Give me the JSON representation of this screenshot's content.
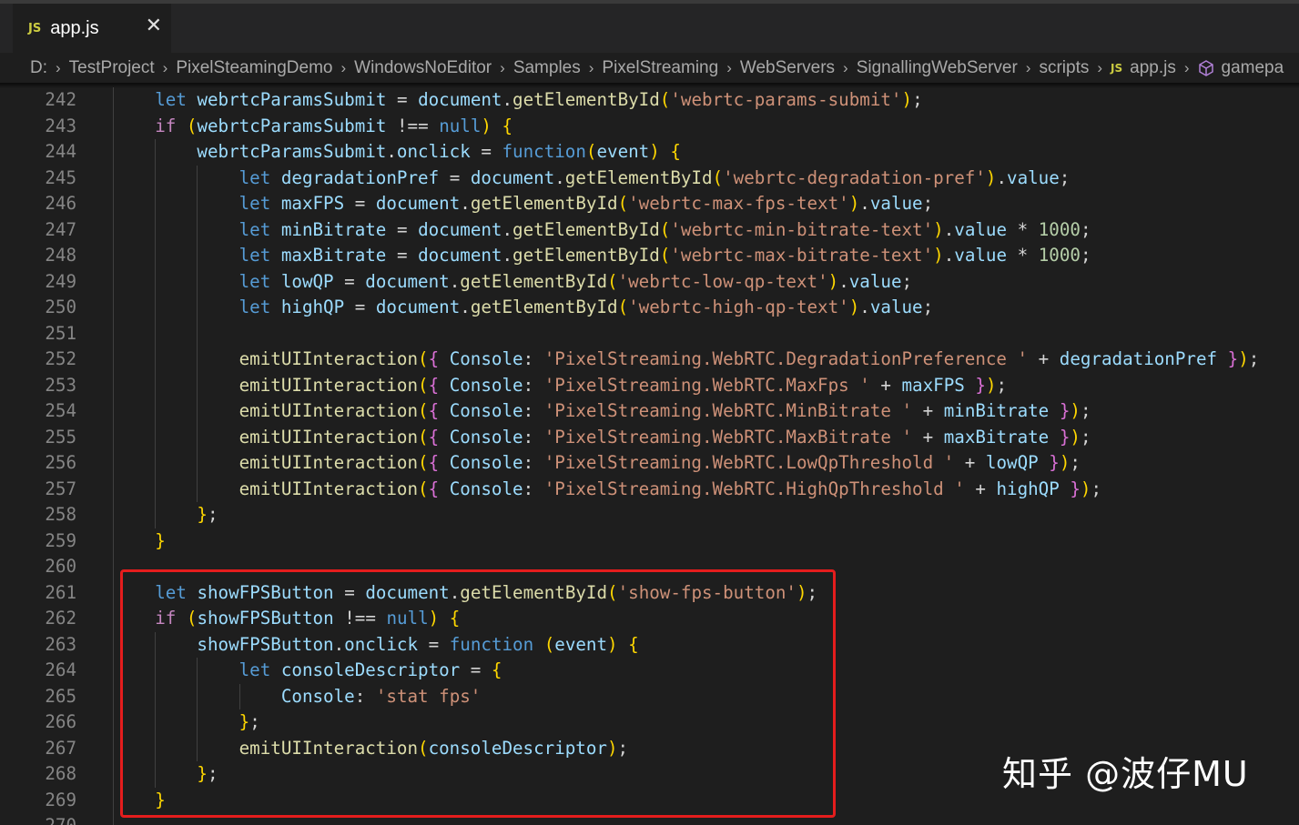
{
  "tab": {
    "icon": "javascript-file-icon",
    "badge": "JS",
    "filename": "app.js"
  },
  "breadcrumb": [
    "D:",
    "TestProject",
    "PixelSteamingDemo",
    "WindowsNoEditor",
    "Samples",
    "PixelStreaming",
    "WebServers",
    "SignallingWebServer",
    "scripts",
    "app.js",
    "gamepa"
  ],
  "code_lines": [
    {
      "n": "242",
      "text": "    let webrtcParamsSubmit = document.getElementById('webrtc-params-submit');"
    },
    {
      "n": "243",
      "text": "    if (webrtcParamsSubmit !== null) {"
    },
    {
      "n": "244",
      "text": "        webrtcParamsSubmit.onclick = function(event) {"
    },
    {
      "n": "245",
      "text": "            let degradationPref = document.getElementById('webrtc-degradation-pref').value;"
    },
    {
      "n": "246",
      "text": "            let maxFPS = document.getElementById('webrtc-max-fps-text').value;"
    },
    {
      "n": "247",
      "text": "            let minBitrate = document.getElementById('webrtc-min-bitrate-text').value * 1000;"
    },
    {
      "n": "248",
      "text": "            let maxBitrate = document.getElementById('webrtc-max-bitrate-text').value * 1000;"
    },
    {
      "n": "249",
      "text": "            let lowQP = document.getElementById('webrtc-low-qp-text').value;"
    },
    {
      "n": "250",
      "text": "            let highQP = document.getElementById('webrtc-high-qp-text').value;"
    },
    {
      "n": "251",
      "text": ""
    },
    {
      "n": "252",
      "text": "            emitUIInteraction({ Console: 'PixelStreaming.WebRTC.DegradationPreference ' + degradationPref });"
    },
    {
      "n": "253",
      "text": "            emitUIInteraction({ Console: 'PixelStreaming.WebRTC.MaxFps ' + maxFPS });"
    },
    {
      "n": "254",
      "text": "            emitUIInteraction({ Console: 'PixelStreaming.WebRTC.MinBitrate ' + minBitrate });"
    },
    {
      "n": "255",
      "text": "            emitUIInteraction({ Console: 'PixelStreaming.WebRTC.MaxBitrate ' + maxBitrate });"
    },
    {
      "n": "256",
      "text": "            emitUIInteraction({ Console: 'PixelStreaming.WebRTC.LowQpThreshold ' + lowQP });"
    },
    {
      "n": "257",
      "text": "            emitUIInteraction({ Console: 'PixelStreaming.WebRTC.HighQpThreshold ' + highQP });"
    },
    {
      "n": "258",
      "text": "        };"
    },
    {
      "n": "259",
      "text": "    }"
    },
    {
      "n": "260",
      "text": ""
    },
    {
      "n": "261",
      "text": "    let showFPSButton = document.getElementById('show-fps-button');"
    },
    {
      "n": "262",
      "text": "    if (showFPSButton !== null) {"
    },
    {
      "n": "263",
      "text": "        showFPSButton.onclick = function (event) {"
    },
    {
      "n": "264",
      "text": "            let consoleDescriptor = {"
    },
    {
      "n": "265",
      "text": "                Console: 'stat fps'"
    },
    {
      "n": "266",
      "text": "            };"
    },
    {
      "n": "267",
      "text": "            emitUIInteraction(consoleDescriptor);"
    },
    {
      "n": "268",
      "text": "        };"
    },
    {
      "n": "269",
      "text": "    }"
    },
    {
      "n": "270",
      "text": ""
    }
  ],
  "highlight_box": {
    "color": "#e51d1d",
    "from_line": "261",
    "to_line": "269"
  },
  "watermark": "知乎 @波仔MU",
  "colors": {
    "editor_bg": "#1e1e1e",
    "keyword": "#569cd6",
    "control": "#c586c0",
    "variable": "#9cdcfe",
    "function": "#dcdcaa",
    "string": "#ce9178",
    "number": "#b5cea8",
    "line_number": "#858585"
  }
}
